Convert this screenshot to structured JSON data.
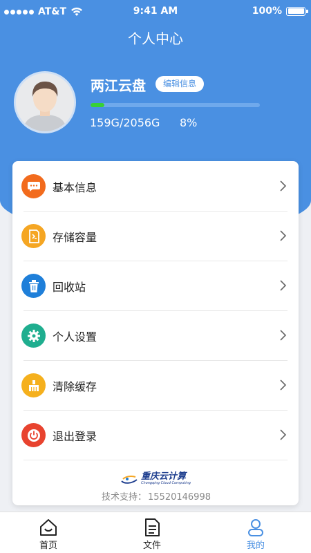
{
  "status": {
    "carrier": "AT&T",
    "time": "9:41 AM",
    "battery": "100%"
  },
  "header": {
    "title": "个人中心"
  },
  "profile": {
    "name": "两江云盘",
    "edit_label": "编辑信息",
    "storage_text": "159G/2056G",
    "storage_percent": "8%",
    "storage_fraction": 0.08
  },
  "menu": [
    {
      "label": "基本信息",
      "icon": "chat-bubble-icon",
      "color": "#f26b1d"
    },
    {
      "label": "存储容量",
      "icon": "storage-card-icon",
      "color": "#f5a623"
    },
    {
      "label": "回收站",
      "icon": "trash-icon",
      "color": "#1f7fd9"
    },
    {
      "label": "个人设置",
      "icon": "gear-icon",
      "color": "#1fae8f"
    },
    {
      "label": "清除缓存",
      "icon": "broom-icon",
      "color": "#f5b01d"
    },
    {
      "label": "退出登录",
      "icon": "power-icon",
      "color": "#e8432f"
    }
  ],
  "footer": {
    "logo_text": "重庆云计算",
    "logo_sub": "Chongqing Cloud Computing",
    "support_label": "技术支持：",
    "support_phone": "15520146998"
  },
  "tabs": [
    {
      "label": "首页"
    },
    {
      "label": "文件"
    },
    {
      "label": "我的"
    }
  ],
  "colors": {
    "primary": "#4a90e2",
    "progress": "#37d136"
  }
}
